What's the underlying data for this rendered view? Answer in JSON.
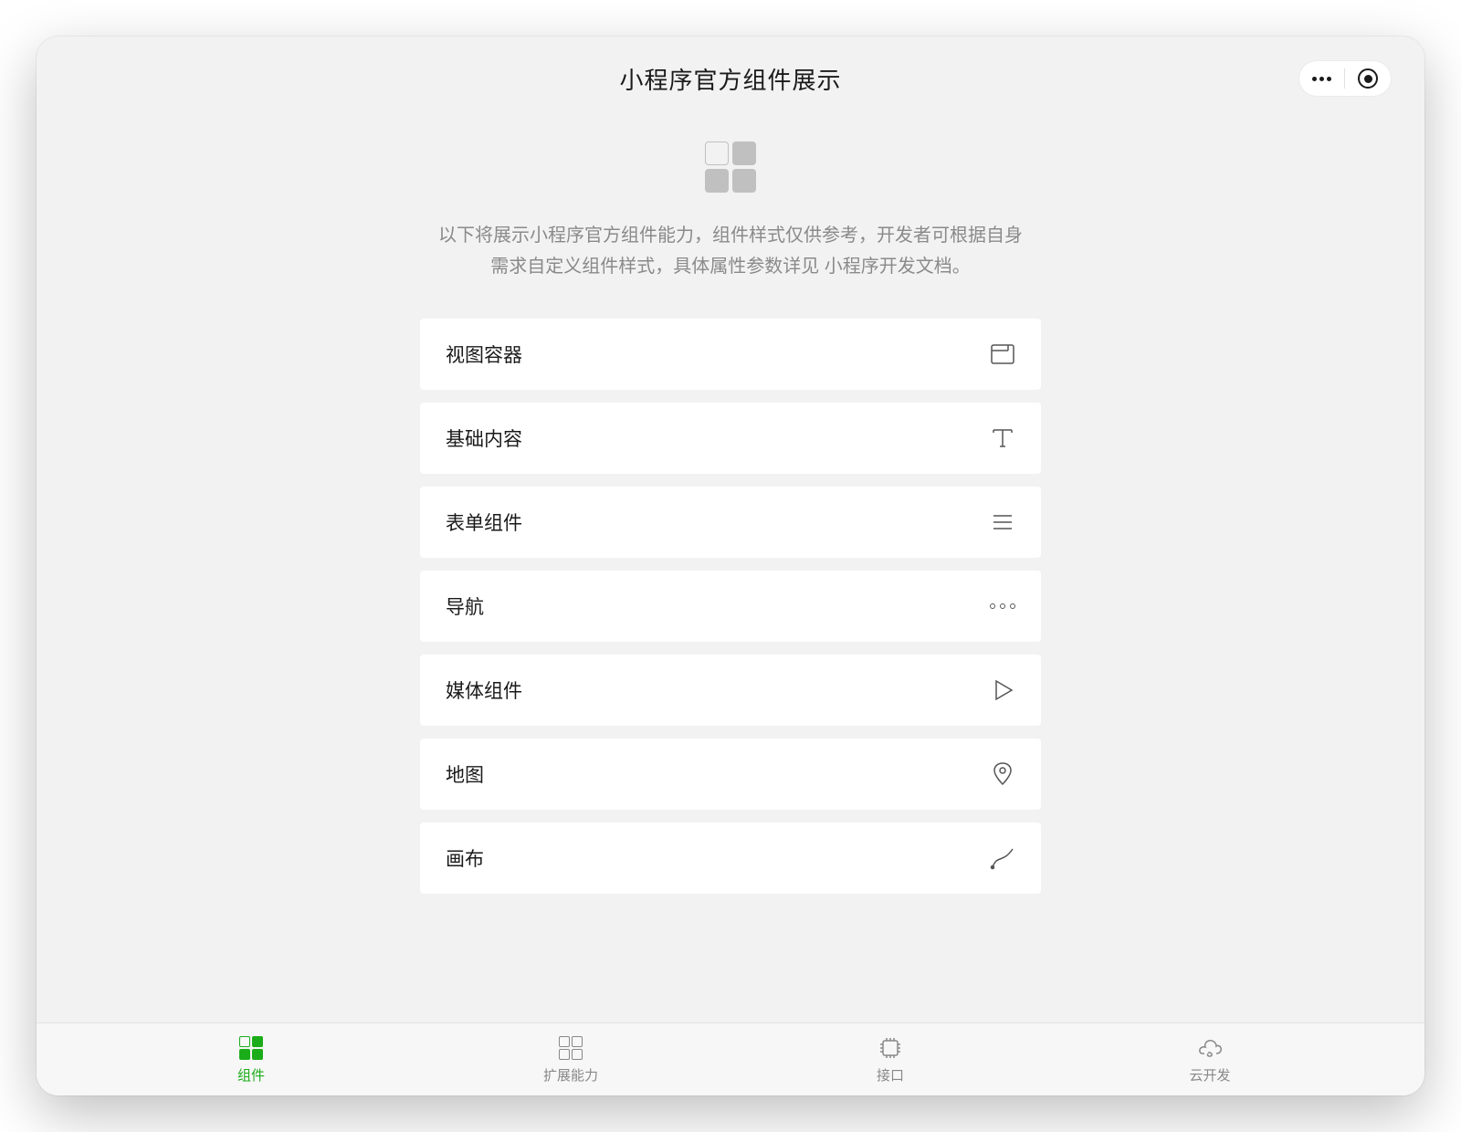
{
  "header": {
    "title": "小程序官方组件展示"
  },
  "intro": {
    "description_part1": "以下将展示小程序官方组件能力，组件样式仅供参考，开发者可根据自身需求自定义组件样式，具体属性参数详见 ",
    "doc_link_text": "小程序开发文档",
    "description_part2": "。"
  },
  "categories": [
    {
      "label": "视图容器",
      "icon": "view-container"
    },
    {
      "label": "基础内容",
      "icon": "text"
    },
    {
      "label": "表单组件",
      "icon": "form"
    },
    {
      "label": "导航",
      "icon": "nav"
    },
    {
      "label": "媒体组件",
      "icon": "media"
    },
    {
      "label": "地图",
      "icon": "map"
    },
    {
      "label": "画布",
      "icon": "canvas"
    }
  ],
  "tabs": [
    {
      "label": "组件",
      "icon": "component",
      "active": true
    },
    {
      "label": "扩展能力",
      "icon": "extension",
      "active": false
    },
    {
      "label": "接口",
      "icon": "api",
      "active": false
    },
    {
      "label": "云开发",
      "icon": "cloud",
      "active": false
    }
  ],
  "colors": {
    "accent": "#1aad19"
  }
}
